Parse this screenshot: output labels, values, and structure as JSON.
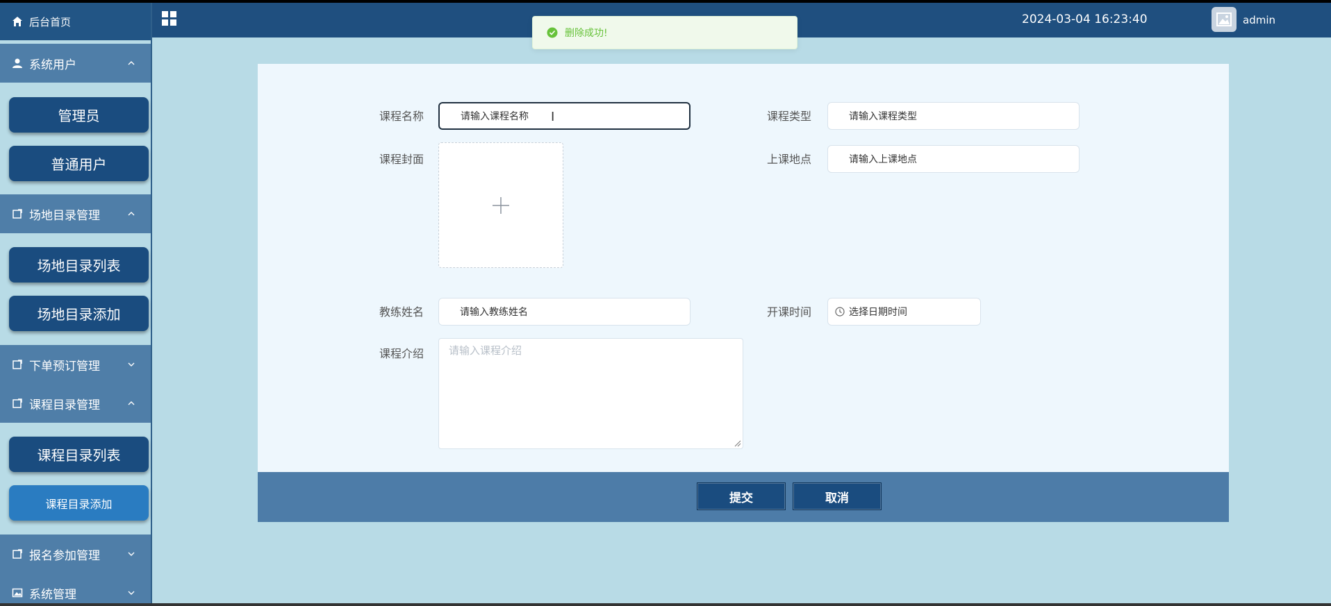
{
  "header": {
    "system_title": "",
    "datetime": "2024-03-04 16:23:40",
    "username": "admin"
  },
  "toast": {
    "message": "删除成功!"
  },
  "sidebar": {
    "home": "后台首页",
    "groups": [
      {
        "label": "系统用户",
        "expanded": true,
        "items": [
          "管理员",
          "普通用户"
        ]
      },
      {
        "label": "场地目录管理",
        "expanded": true,
        "items": [
          "场地目录列表",
          "场地目录添加"
        ]
      },
      {
        "label": "下单预订管理",
        "expanded": false,
        "items": []
      },
      {
        "label": "课程目录管理",
        "expanded": true,
        "items": [
          "课程目录列表",
          "课程目录添加"
        ],
        "active_item": "课程目录添加"
      },
      {
        "label": "报名参加管理",
        "expanded": false,
        "items": []
      },
      {
        "label": "系统管理",
        "expanded": false,
        "items": []
      }
    ]
  },
  "form": {
    "course_name": {
      "label": "课程名称",
      "placeholder": "请输入课程名称"
    },
    "course_type": {
      "label": "课程类型",
      "placeholder": "请输入课程类型"
    },
    "course_cover": {
      "label": "课程封面"
    },
    "location": {
      "label": "上课地点",
      "placeholder": "请输入上课地点"
    },
    "coach_name": {
      "label": "教练姓名",
      "placeholder": "请输入教练姓名"
    },
    "start_time": {
      "label": "开课时间",
      "placeholder": "选择日期时间"
    },
    "intro": {
      "label": "课程介绍",
      "placeholder": "请输入课程介绍"
    },
    "submit_label": "提交",
    "cancel_label": "取消"
  },
  "colors": {
    "header_bg": "#1f4f7f",
    "page_bg": "#b8dbe6",
    "menu_head_bg": "#4f7ea8",
    "sub_btn_bg": "#1a4c7f",
    "active_btn_bg": "#2a7cc1",
    "toast_text": "#67c23a"
  }
}
